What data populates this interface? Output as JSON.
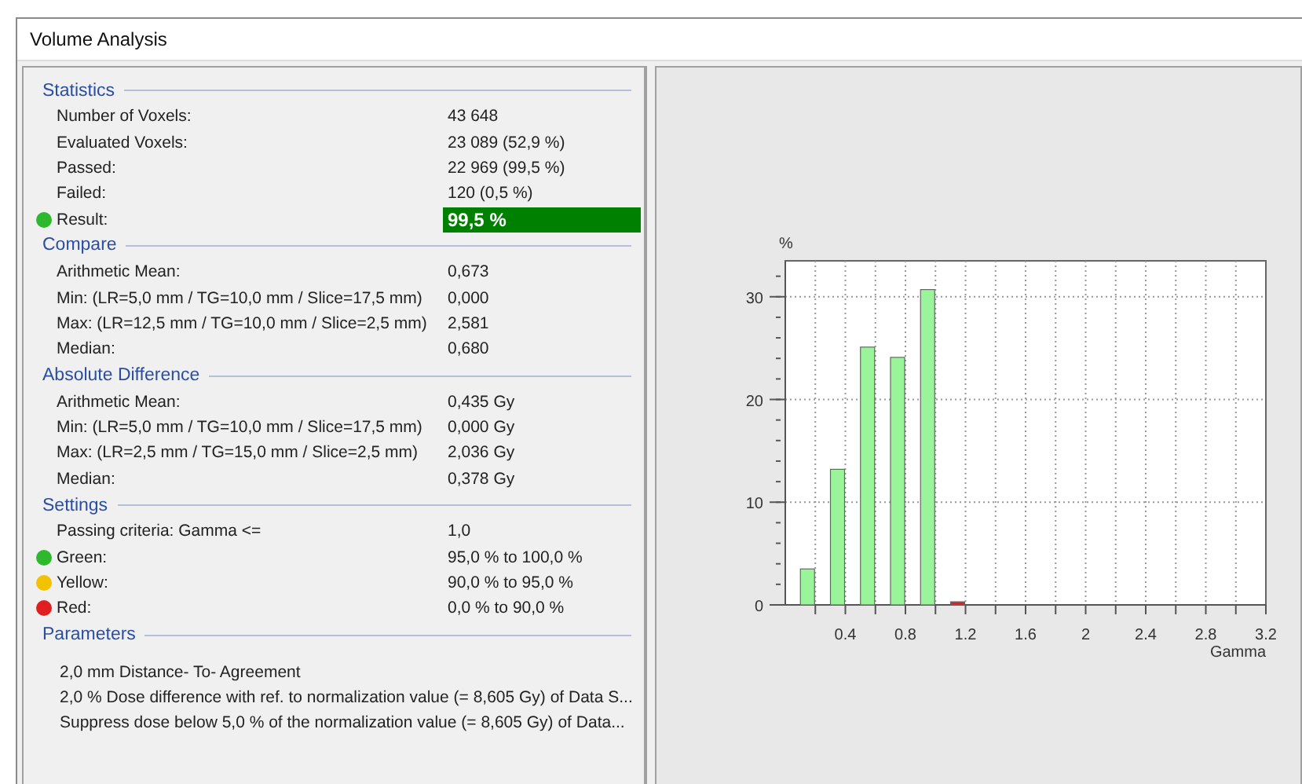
{
  "window": {
    "title": "Volume Analysis"
  },
  "sections": [
    {
      "title": "Statistics",
      "rows": [
        {
          "label": "Number of Voxels:",
          "value": "43 648"
        },
        {
          "label": "Evaluated Voxels:",
          "value": "23 089 (52,9 %)"
        },
        {
          "label": "Passed:",
          "value": "22 969 (99,5 %)"
        },
        {
          "label": "Failed:",
          "value": "120 (0,5 %)"
        },
        {
          "label": "Result:",
          "value": "99,5 %",
          "color": "#2db82d",
          "highlight": true
        }
      ]
    },
    {
      "title": "Compare",
      "rows": [
        {
          "label": "Arithmetic Mean:",
          "value": "0,673"
        },
        {
          "label": "Min: (LR=5,0 mm / TG=10,0 mm / Slice=17,5 mm)",
          "value": "0,000"
        },
        {
          "label": "Max: (LR=12,5 mm / TG=10,0 mm / Slice=2,5 mm)",
          "value": "2,581"
        },
        {
          "label": "Median:",
          "value": "0,680"
        }
      ]
    },
    {
      "title": "Absolute Difference",
      "rows": [
        {
          "label": "Arithmetic Mean:",
          "value": "0,435 Gy"
        },
        {
          "label": "Min: (LR=5,0 mm / TG=10,0 mm / Slice=17,5 mm)",
          "value": "0,000 Gy"
        },
        {
          "label": "Max: (LR=2,5 mm / TG=15,0 mm / Slice=2,5 mm)",
          "value": "2,036 Gy"
        },
        {
          "label": "Median:",
          "value": "0,378 Gy"
        }
      ]
    },
    {
      "title": "Settings",
      "rows": [
        {
          "label": "Passing criteria: Gamma <=",
          "value": "1,0"
        },
        {
          "label": "Green:",
          "value": "95,0 % to 100,0 %",
          "color": "#2db82d"
        },
        {
          "label": "Yellow:",
          "value": "90,0 % to 95,0 %",
          "color": "#f2c200"
        },
        {
          "label": "Red:",
          "value": "0,0 % to 90,0 %",
          "color": "#e02020"
        }
      ]
    }
  ],
  "parameters": {
    "title": "Parameters",
    "lines": [
      "2,0 mm Distance- To- Agreement",
      "2,0 % Dose difference with ref. to normalization value (= 8,605 Gy) of Data S...",
      "Suppress dose below 5,0 % of the normalization value (= 8,605 Gy) of Data..."
    ]
  },
  "histogram": {
    "chart_data": {
      "type": "bar",
      "ylabel": "%",
      "xlabel": "Gamma",
      "x": [
        0.2,
        0.4,
        0.6,
        0.8,
        1.0,
        1.2
      ],
      "series": [
        {
          "color": "#9af59a",
          "values": [
            3.5,
            13.2,
            25.1,
            24.1,
            30.7,
            null
          ]
        },
        {
          "color": "#e02020",
          "values": [
            null,
            null,
            null,
            null,
            null,
            0.3
          ]
        }
      ],
      "grid": true,
      "xlim": [
        0,
        3.2
      ],
      "ylim": [
        0,
        33.5
      ],
      "xticks": [
        0.4,
        0.8,
        1.2,
        1.6,
        2,
        2.4,
        2.8,
        3.2
      ],
      "yticks": [
        0,
        10,
        20,
        30
      ]
    }
  }
}
